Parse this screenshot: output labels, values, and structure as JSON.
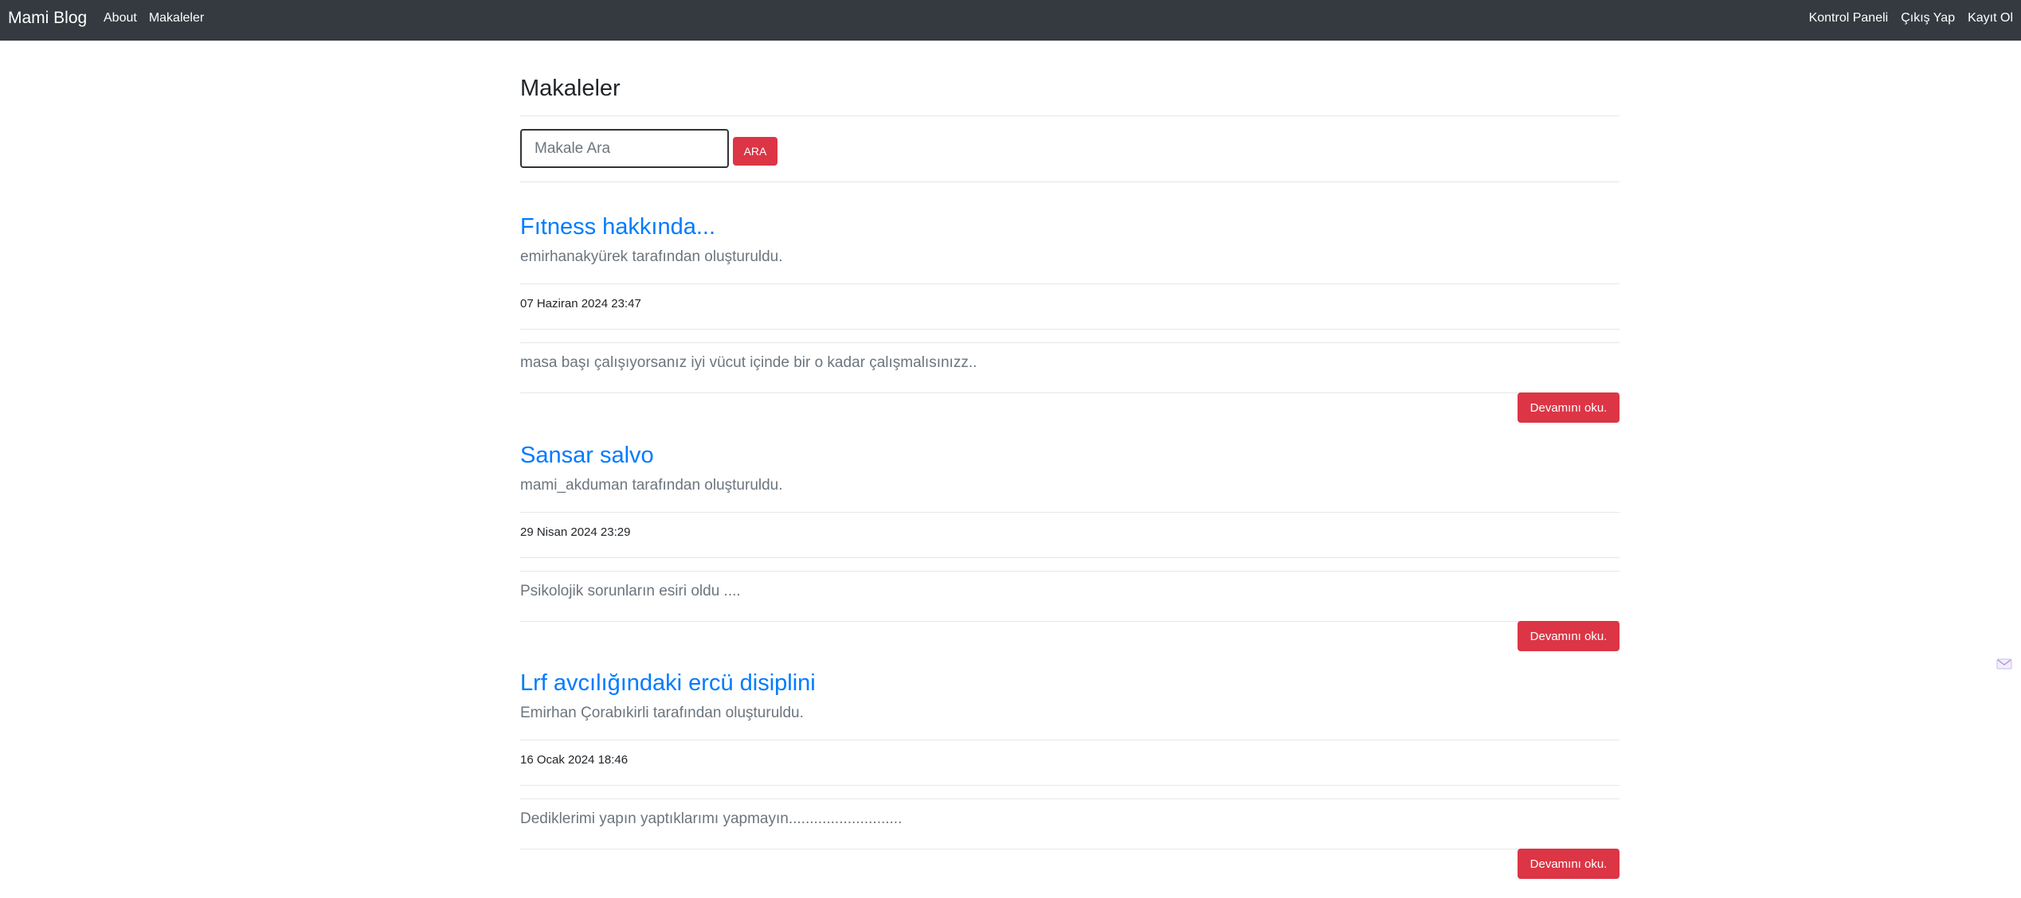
{
  "navbar": {
    "brand": "Mami Blog",
    "left_links": [
      "About",
      "Makaleler"
    ],
    "right_links": [
      "Kontrol Paneli",
      "Çıkış Yap",
      "Kayıt Ol"
    ]
  },
  "main": {
    "title": "Makaleler",
    "search": {
      "placeholder": "Makale Ara",
      "value": "",
      "button_label": "ARA"
    },
    "articles": [
      {
        "title": "Fıtness hakkında...",
        "author": "emirhanakyürek tarafından oluşturuldu.",
        "date": "07 Haziran 2024 23:47",
        "excerpt": "masa başı çalışıyorsanız iyi vücut içinde bir o kadar çalışmalısınızz..",
        "read_more": "Devamını oku."
      },
      {
        "title": "Sansar salvo",
        "author": "mami_akduman tarafından oluşturuldu.",
        "date": "29 Nisan 2024 23:29",
        "excerpt": "Psikolojik sorunların esiri oldu ....",
        "read_more": "Devamını oku."
      },
      {
        "title": "Lrf avcılığındaki ercü disiplini",
        "author": "Emirhan Çorabıkirli tarafından oluşturuldu.",
        "date": "16 Ocak 2024 18:46",
        "excerpt": "Dediklerimi yapın yaptıklarımı yapmayın...........................",
        "read_more": "Devamını oku."
      }
    ]
  },
  "colors": {
    "navbar_bg": "#343a40",
    "link": "#007bff",
    "danger": "#dc3545",
    "muted": "#6c757d"
  },
  "icons": {
    "side_widget": "mail-icon"
  }
}
